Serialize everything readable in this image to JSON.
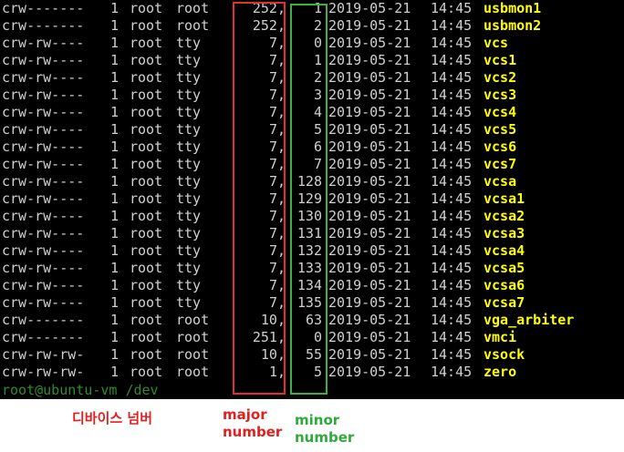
{
  "terminal": {
    "rows": [
      {
        "perm": "crw-------",
        "links": "1",
        "owner": "root",
        "group": "root",
        "major": "252,",
        "minor": "1",
        "date": "2019-05-21",
        "time": "14:45",
        "name": "usbmon1"
      },
      {
        "perm": "crw-------",
        "links": "1",
        "owner": "root",
        "group": "root",
        "major": "252,",
        "minor": "2",
        "date": "2019-05-21",
        "time": "14:45",
        "name": "usbmon2"
      },
      {
        "perm": "crw-rw----",
        "links": "1",
        "owner": "root",
        "group": "tty",
        "major": "7,",
        "minor": "0",
        "date": "2019-05-21",
        "time": "14:45",
        "name": "vcs"
      },
      {
        "perm": "crw-rw----",
        "links": "1",
        "owner": "root",
        "group": "tty",
        "major": "7,",
        "minor": "1",
        "date": "2019-05-21",
        "time": "14:45",
        "name": "vcs1"
      },
      {
        "perm": "crw-rw----",
        "links": "1",
        "owner": "root",
        "group": "tty",
        "major": "7,",
        "minor": "2",
        "date": "2019-05-21",
        "time": "14:45",
        "name": "vcs2"
      },
      {
        "perm": "crw-rw----",
        "links": "1",
        "owner": "root",
        "group": "tty",
        "major": "7,",
        "minor": "3",
        "date": "2019-05-21",
        "time": "14:45",
        "name": "vcs3"
      },
      {
        "perm": "crw-rw----",
        "links": "1",
        "owner": "root",
        "group": "tty",
        "major": "7,",
        "minor": "4",
        "date": "2019-05-21",
        "time": "14:45",
        "name": "vcs4"
      },
      {
        "perm": "crw-rw----",
        "links": "1",
        "owner": "root",
        "group": "tty",
        "major": "7,",
        "minor": "5",
        "date": "2019-05-21",
        "time": "14:45",
        "name": "vcs5"
      },
      {
        "perm": "crw-rw----",
        "links": "1",
        "owner": "root",
        "group": "tty",
        "major": "7,",
        "minor": "6",
        "date": "2019-05-21",
        "time": "14:45",
        "name": "vcs6"
      },
      {
        "perm": "crw-rw----",
        "links": "1",
        "owner": "root",
        "group": "tty",
        "major": "7,",
        "minor": "7",
        "date": "2019-05-21",
        "time": "14:45",
        "name": "vcs7"
      },
      {
        "perm": "crw-rw----",
        "links": "1",
        "owner": "root",
        "group": "tty",
        "major": "7,",
        "minor": "128",
        "date": "2019-05-21",
        "time": "14:45",
        "name": "vcsa"
      },
      {
        "perm": "crw-rw----",
        "links": "1",
        "owner": "root",
        "group": "tty",
        "major": "7,",
        "minor": "129",
        "date": "2019-05-21",
        "time": "14:45",
        "name": "vcsa1"
      },
      {
        "perm": "crw-rw----",
        "links": "1",
        "owner": "root",
        "group": "tty",
        "major": "7,",
        "minor": "130",
        "date": "2019-05-21",
        "time": "14:45",
        "name": "vcsa2"
      },
      {
        "perm": "crw-rw----",
        "links": "1",
        "owner": "root",
        "group": "tty",
        "major": "7,",
        "minor": "131",
        "date": "2019-05-21",
        "time": "14:45",
        "name": "vcsa3"
      },
      {
        "perm": "crw-rw----",
        "links": "1",
        "owner": "root",
        "group": "tty",
        "major": "7,",
        "minor": "132",
        "date": "2019-05-21",
        "time": "14:45",
        "name": "vcsa4"
      },
      {
        "perm": "crw-rw----",
        "links": "1",
        "owner": "root",
        "group": "tty",
        "major": "7,",
        "minor": "133",
        "date": "2019-05-21",
        "time": "14:45",
        "name": "vcsa5"
      },
      {
        "perm": "crw-rw----",
        "links": "1",
        "owner": "root",
        "group": "tty",
        "major": "7,",
        "minor": "134",
        "date": "2019-05-21",
        "time": "14:45",
        "name": "vcsa6"
      },
      {
        "perm": "crw-rw----",
        "links": "1",
        "owner": "root",
        "group": "tty",
        "major": "7,",
        "minor": "135",
        "date": "2019-05-21",
        "time": "14:45",
        "name": "vcsa7"
      },
      {
        "perm": "crw-------",
        "links": "1",
        "owner": "root",
        "group": "root",
        "major": "10,",
        "minor": "63",
        "date": "2019-05-21",
        "time": "14:45",
        "name": "vga_arbiter"
      },
      {
        "perm": "crw-------",
        "links": "1",
        "owner": "root",
        "group": "root",
        "major": "251,",
        "minor": "0",
        "date": "2019-05-21",
        "time": "14:45",
        "name": "vmci"
      },
      {
        "perm": "crw-rw-rw-",
        "links": "1",
        "owner": "root",
        "group": "root",
        "major": "10,",
        "minor": "55",
        "date": "2019-05-21",
        "time": "14:45",
        "name": "vsock"
      },
      {
        "perm": "crw-rw-rw-",
        "links": "1",
        "owner": "root",
        "group": "root",
        "major": "1,",
        "minor": "5",
        "date": "2019-05-21",
        "time": "14:45",
        "name": "zero"
      }
    ],
    "prompt": {
      "user_host": "root@ubuntu-vm",
      "path": "/dev"
    }
  },
  "annotations": {
    "device_number": "디바이스 넘버",
    "major_number": "major number",
    "minor_number": "minor number"
  },
  "colors": {
    "terminal_background": "#000000",
    "terminal_text": "#d0d0d0",
    "filename": "#ffff00",
    "prompt": "#2e8b2e",
    "major_box": "#e03030",
    "minor_box": "#3cb040"
  }
}
